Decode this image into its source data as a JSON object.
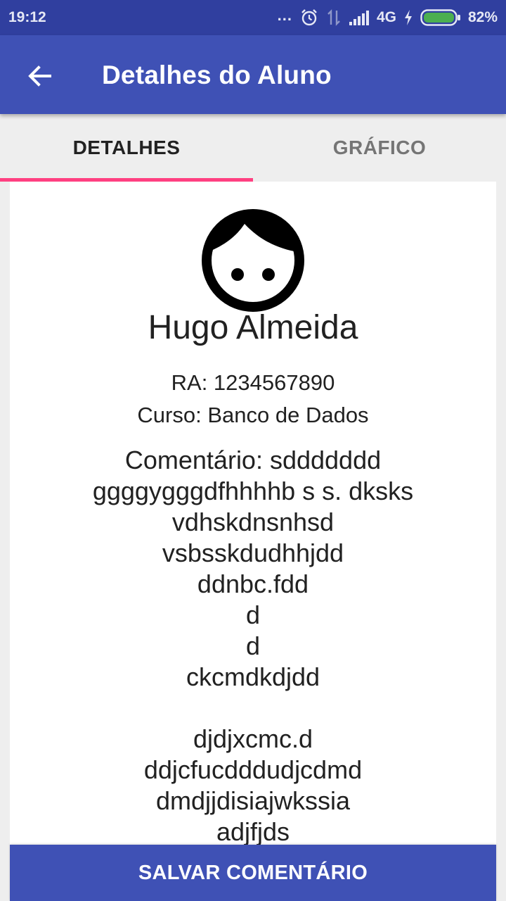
{
  "status_bar": {
    "time": "19:12",
    "dots": "...",
    "network": "4G",
    "battery": "82%",
    "icons": [
      "alarm-icon",
      "data-transfer-icon",
      "signal-icon",
      "charging-icon",
      "battery-icon"
    ],
    "battery_color": "#4caf50"
  },
  "app_bar": {
    "title": "Detalhes do Aluno",
    "back_icon": "arrow-back-icon"
  },
  "tabs": [
    {
      "label": "DETALHES",
      "selected": true
    },
    {
      "label": "GRÁFICO",
      "selected": false
    }
  ],
  "student": {
    "avatar_icon": "face-icon",
    "name": "Hugo Almeida",
    "ra": "RA: 1234567890",
    "course": "Curso: Banco de Dados",
    "comment": "Comentário: sddddddd\nggggygggdfhhhhb s s. dksks\nvdhskdnsnhsd\nvsbsskdudhhjdd\nddnbc.fdd\nd\nd\nckcmdkdjdd\n\ndjdjxcmc.d\nddjcfucdddudjcdmd\ndmdjjdisiajwkssia\nadjfjds"
  },
  "actions": {
    "save_label": "SALVAR COMENTÁRIO"
  },
  "colors": {
    "primary": "#3f51b5",
    "primary_dark": "#303f9f",
    "accent": "#ff4081"
  }
}
